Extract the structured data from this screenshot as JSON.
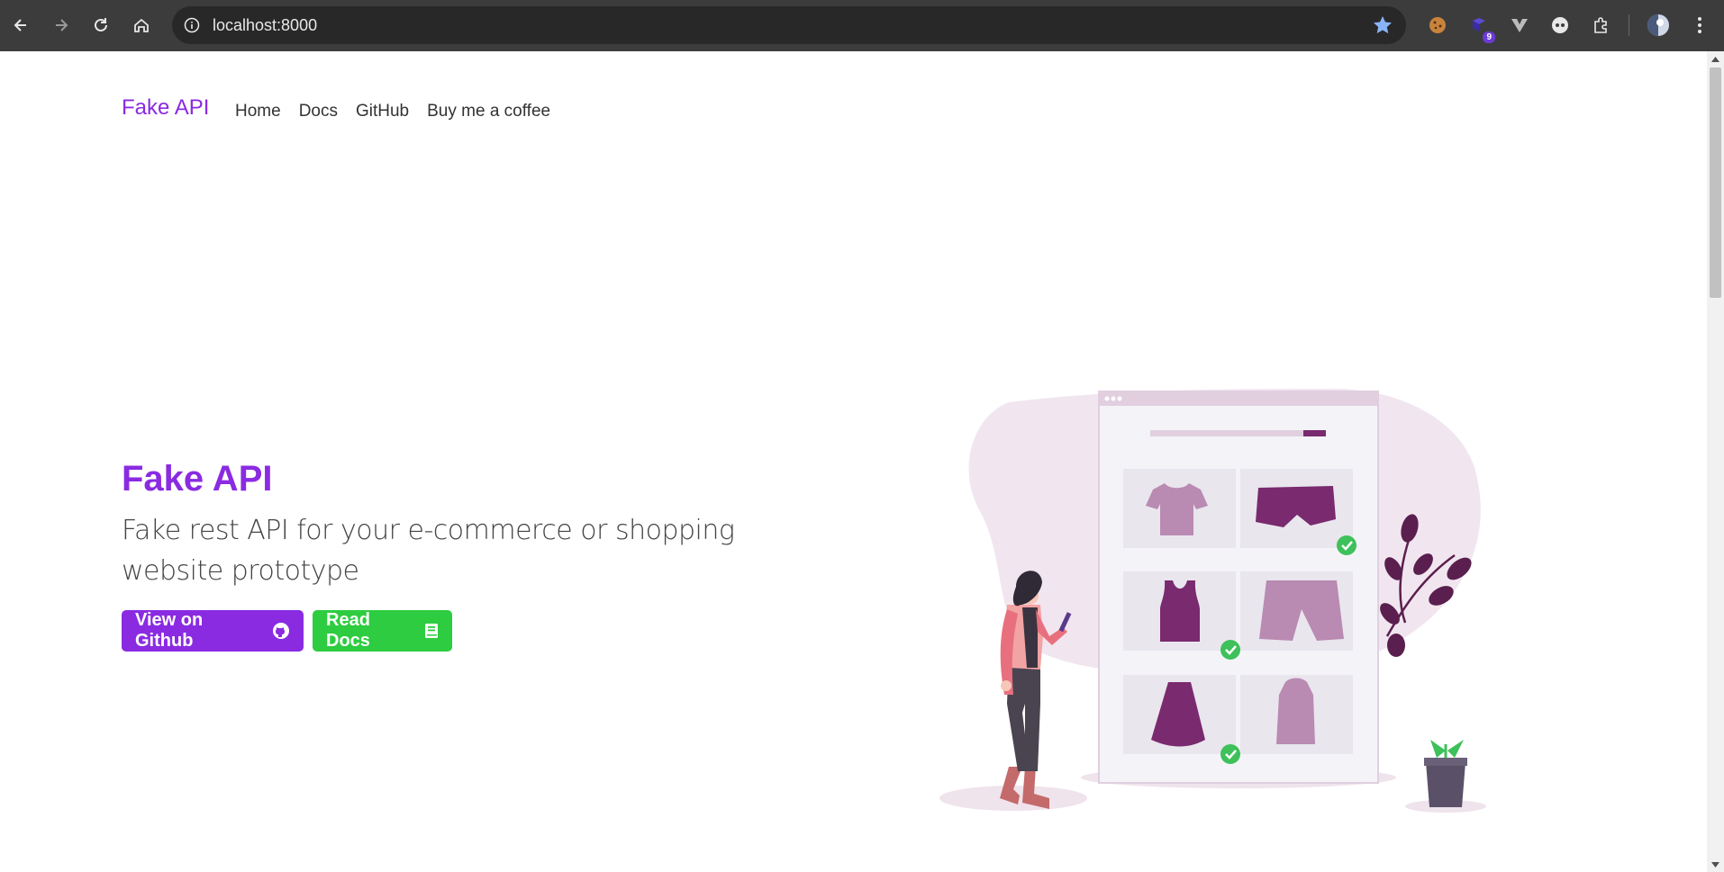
{
  "browser": {
    "url": "localhost:8000",
    "extension_badge": "9",
    "icons": [
      "back-icon",
      "forward-icon",
      "reload-icon",
      "home-icon",
      "site-info-icon",
      "bookmark-star-icon",
      "cookie-extension-icon",
      "extension-icon",
      "vue-devtools-icon",
      "extension-icon",
      "extensions-puzzle-icon",
      "profile-avatar",
      "menu-kebab-icon"
    ]
  },
  "navbar": {
    "brand": "Fake API",
    "links": [
      "Home",
      "Docs",
      "GitHub",
      "Buy me a coffee"
    ]
  },
  "hero": {
    "title": "Fake API",
    "subtitle": "Fake rest API for your e-commerce or shopping website prototype",
    "github_button": "View on Github",
    "docs_button": "Read Docs"
  },
  "colors": {
    "brand": "#8a2be2",
    "docs_button": "#2ecc40",
    "illustration_accent": "#7a2a6e"
  }
}
